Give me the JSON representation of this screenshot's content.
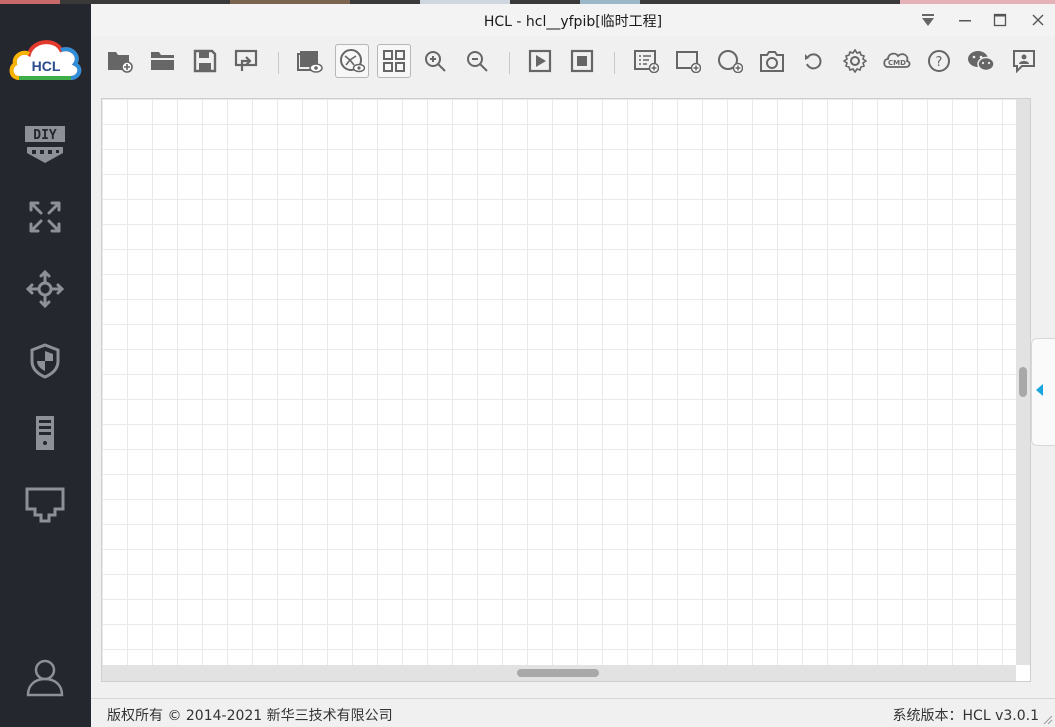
{
  "window": {
    "title": "HCL - hcl__yfpib[临时工程]"
  },
  "logo": {
    "text": "HCL"
  },
  "sidebar": {
    "items": [
      {
        "name": "diy-device",
        "icon": "diy-icon"
      },
      {
        "name": "router",
        "icon": "router-icon"
      },
      {
        "name": "switch",
        "icon": "switch-icon"
      },
      {
        "name": "firewall",
        "icon": "shield-icon"
      },
      {
        "name": "server",
        "icon": "server-icon"
      },
      {
        "name": "pc-terminal",
        "icon": "monitor-icon"
      },
      {
        "name": "user",
        "icon": "user-icon"
      }
    ]
  },
  "toolbar": {
    "items": [
      "new-project",
      "open-project",
      "save-project",
      "export",
      "capture-view",
      "topology-view",
      "grid-view",
      "zoom-in",
      "zoom-out",
      "start-all",
      "stop-all",
      "add-text",
      "add-rectangle",
      "add-ellipse",
      "screenshot",
      "undo",
      "settings",
      "cmd",
      "help",
      "wechat",
      "feedback"
    ]
  },
  "status": {
    "copyright": "版权所有 © 2014-2021 新华三技术有限公司",
    "version": "系统版本：HCL v3.0.1"
  },
  "colors": {
    "sidebar": "#24272d",
    "accent": "#1aa6dc",
    "grid": "#e9e9e9"
  }
}
